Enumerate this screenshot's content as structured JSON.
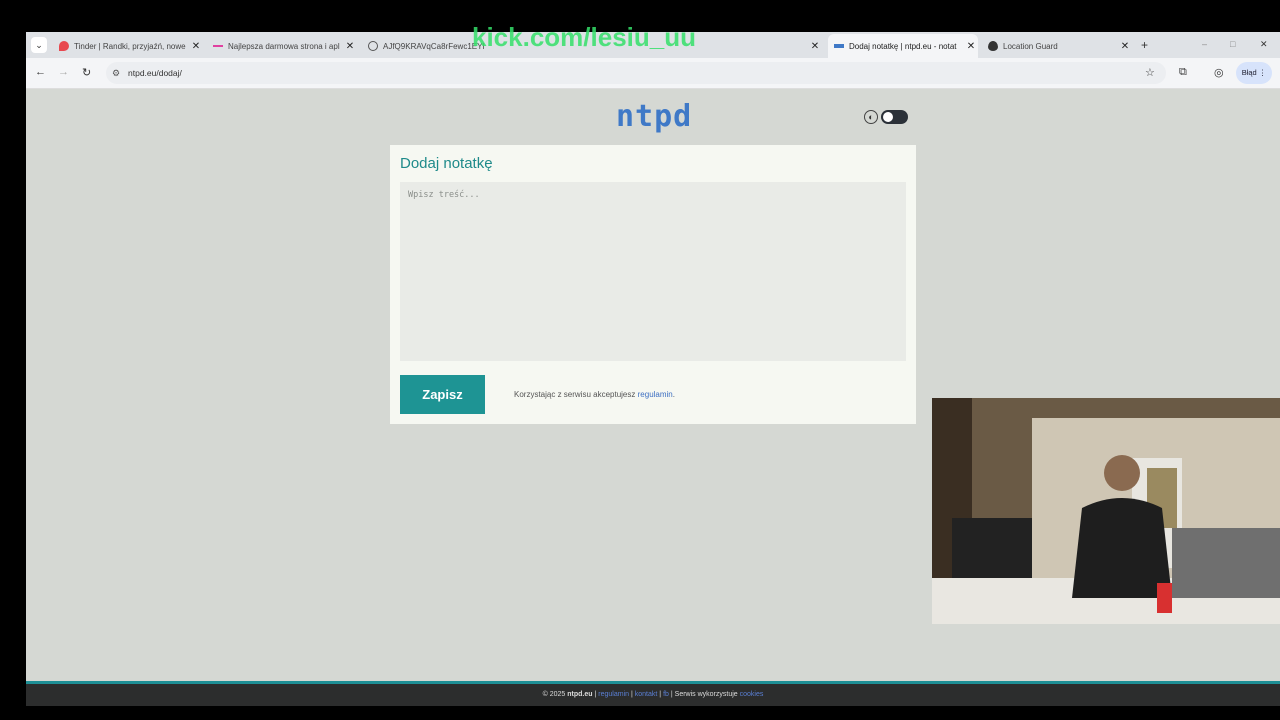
{
  "tabs": [
    {
      "title": "Tinder | Randki, przyjaźń, nowe",
      "favicon_color": "#e8484f"
    },
    {
      "title": "Najlepsza darmowa strona i apl",
      "favicon_color": "#e040a0"
    },
    {
      "title": "AJfQ9KRAVqCa8rFewc1EYI",
      "favicon_color": "#555555"
    },
    {
      "title": "Dodaj notatkę | ntpd.eu - notat",
      "favicon_color": "#3f79c7",
      "active": true
    },
    {
      "title": "Location Guard",
      "favicon_color": "#333333"
    }
  ],
  "new_tab_label": "+",
  "window_controls": {
    "minimize": "–",
    "maximize": "□",
    "close": "✕"
  },
  "address_bar": {
    "url": "ntpd.eu/dodaj/"
  },
  "profile_label": "Błąd",
  "page": {
    "logo": "ntpd",
    "card_title": "Dodaj notatkę",
    "note_placeholder": "Wpisz treść...",
    "save_label": "Zapisz",
    "terms_text": "Korzystając z serwisu akceptujesz",
    "terms_link": "regulamin",
    "terms_end": "."
  },
  "footer": {
    "copyright": "© 2025",
    "site": "ntpd.eu",
    "sep1": "|",
    "link_regulamin": "regulamin",
    "sep2": "|",
    "link_kontakt": "kontakt",
    "sep3": "|",
    "link_fb": "fb",
    "sep4": "|",
    "cookies_text": "Serwis wykorzystuje",
    "link_cookies": "cookies"
  },
  "overlay_watermark": "kick.com/lesiu_uu",
  "colors": {
    "accent": "#1e9494",
    "logo": "#3f79c7",
    "background": "#d5d8d3"
  }
}
